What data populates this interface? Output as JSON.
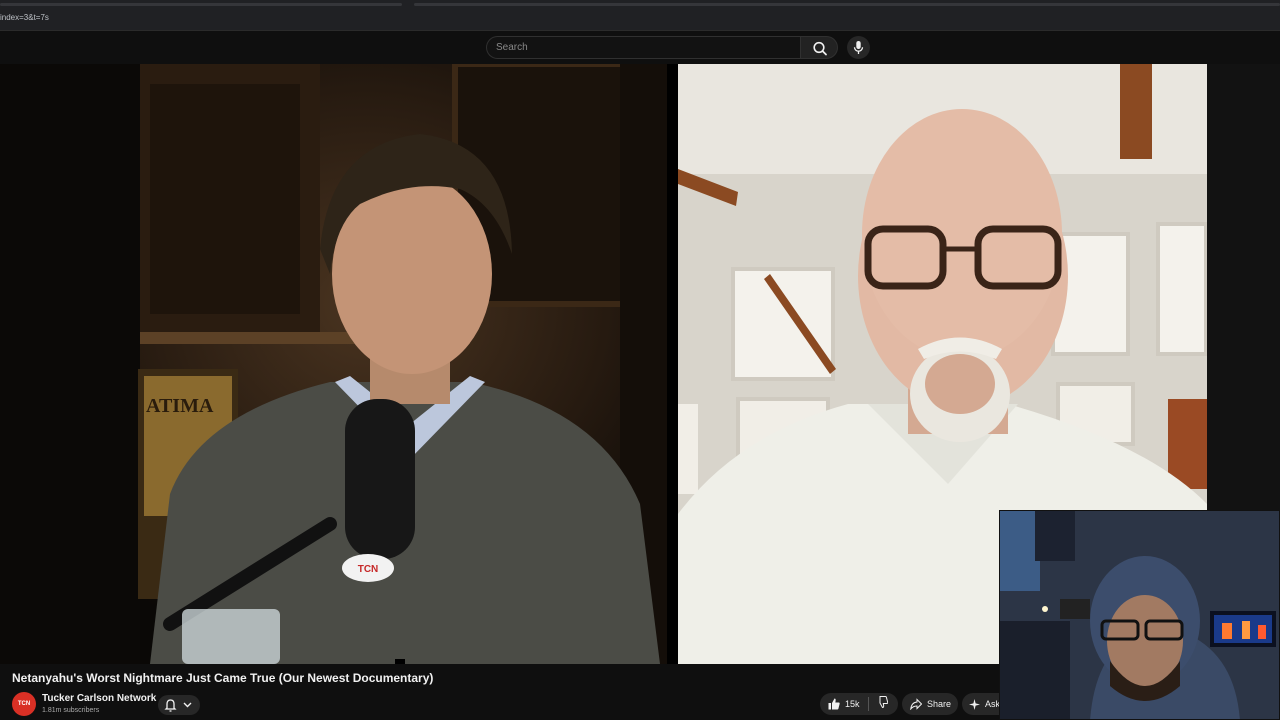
{
  "browser": {
    "url_fragment": "index=3&t=7s"
  },
  "topbar": {
    "search_placeholder": "Search",
    "search_icon": "search-icon",
    "mic_icon": "microphone-icon"
  },
  "video": {
    "overlay_logo": "TCN",
    "poster_text": "ATIMA"
  },
  "meta": {
    "title": "Netanyahu's Worst Nightmare Just Came True (Our Newest Documentary)",
    "channel_name": "Tucker Carlson Network",
    "channel_avatar_text": "TCN",
    "subscribers": "1.81m subscribers"
  },
  "actions": {
    "like_count": "15k",
    "share_label": "Share",
    "ask_label": "Ask"
  },
  "colors": {
    "accent": "#d93025",
    "background": "#0f0f0f",
    "pill": "#272727"
  }
}
